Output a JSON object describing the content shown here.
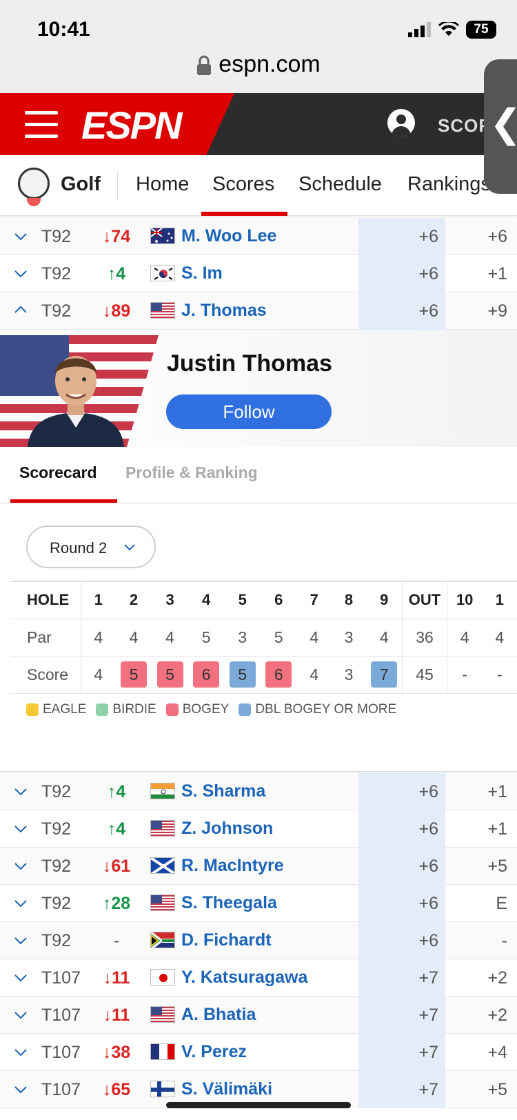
{
  "status": {
    "time": "10:41",
    "battery": "75",
    "url": "espn.com"
  },
  "header": {
    "logo": "ESPN",
    "right_label": "SCOR",
    "side_handle": "❮"
  },
  "subnav": {
    "sport": "Golf",
    "items": [
      "Home",
      "Scores",
      "Schedule",
      "Rankings"
    ],
    "active": "Scores"
  },
  "rows_top": [
    {
      "pos": "T92",
      "move": "↓74",
      "dir": "down",
      "flag": "AUS",
      "name": "M. Woo Lee",
      "today": "+6",
      "rnd": "+6"
    },
    {
      "pos": "T92",
      "move": "↑4",
      "dir": "up",
      "flag": "KOR",
      "name": "S. Im",
      "today": "+6",
      "rnd": "+1"
    },
    {
      "pos": "T92",
      "move": "↓89",
      "dir": "down",
      "flag": "USA",
      "name": "J. Thomas",
      "today": "+6",
      "rnd": "+9",
      "expanded": true
    }
  ],
  "player": {
    "name": "Justin Thomas",
    "follow_label": "Follow"
  },
  "tabs": {
    "active": "Scorecard",
    "inactive": "Profile & Ranking"
  },
  "round_selector": "Round 2",
  "scorecard": {
    "headers": [
      "HOLE",
      "1",
      "2",
      "3",
      "4",
      "5",
      "6",
      "7",
      "8",
      "9",
      "OUT",
      "10",
      "1"
    ],
    "par": [
      "Par",
      "4",
      "4",
      "4",
      "5",
      "3",
      "5",
      "4",
      "3",
      "4",
      "36",
      "4",
      "4"
    ],
    "score": [
      "Score",
      "4",
      "5",
      "5",
      "6",
      "5",
      "6",
      "4",
      "3",
      "7",
      "45",
      "-",
      "-"
    ],
    "score_types": [
      "",
      "",
      "bogey",
      "bogey",
      "bogey",
      "dbl",
      "bogey",
      "",
      "",
      "dbl",
      "",
      "",
      ""
    ]
  },
  "legend": [
    {
      "label": "EAGLE",
      "color": "#f5c935"
    },
    {
      "label": "BIRDIE",
      "color": "#8fd1a8"
    },
    {
      "label": "BOGEY",
      "color": "#f2707f"
    },
    {
      "label": "DBL BOGEY OR MORE",
      "color": "#7baad9"
    }
  ],
  "rows_bottom": [
    {
      "pos": "T92",
      "move": "↑4",
      "dir": "up",
      "flag": "IND",
      "name": "S. Sharma",
      "today": "+6",
      "rnd": "+1"
    },
    {
      "pos": "T92",
      "move": "↑4",
      "dir": "up",
      "flag": "USA",
      "name": "Z. Johnson",
      "today": "+6",
      "rnd": "+1"
    },
    {
      "pos": "T92",
      "move": "↓61",
      "dir": "down",
      "flag": "SCO",
      "name": "R. MacIntyre",
      "today": "+6",
      "rnd": "+5"
    },
    {
      "pos": "T92",
      "move": "↑28",
      "dir": "up",
      "flag": "USA",
      "name": "S. Theegala",
      "today": "+6",
      "rnd": "E"
    },
    {
      "pos": "T92",
      "move": "-",
      "dir": "none",
      "flag": "RSA",
      "name": "D. Fichardt",
      "today": "+6",
      "rnd": "-"
    },
    {
      "pos": "T107",
      "move": "↓11",
      "dir": "down",
      "flag": "JPN",
      "name": "Y. Katsuragawa",
      "today": "+7",
      "rnd": "+2"
    },
    {
      "pos": "T107",
      "move": "↓11",
      "dir": "down",
      "flag": "USA",
      "name": "A. Bhatia",
      "today": "+7",
      "rnd": "+2"
    },
    {
      "pos": "T107",
      "move": "↓38",
      "dir": "down",
      "flag": "FRA",
      "name": "V. Perez",
      "today": "+7",
      "rnd": "+4"
    },
    {
      "pos": "T107",
      "move": "↓65",
      "dir": "down",
      "flag": "FIN",
      "name": "S. Välimäki",
      "today": "+7",
      "rnd": "+5"
    }
  ]
}
